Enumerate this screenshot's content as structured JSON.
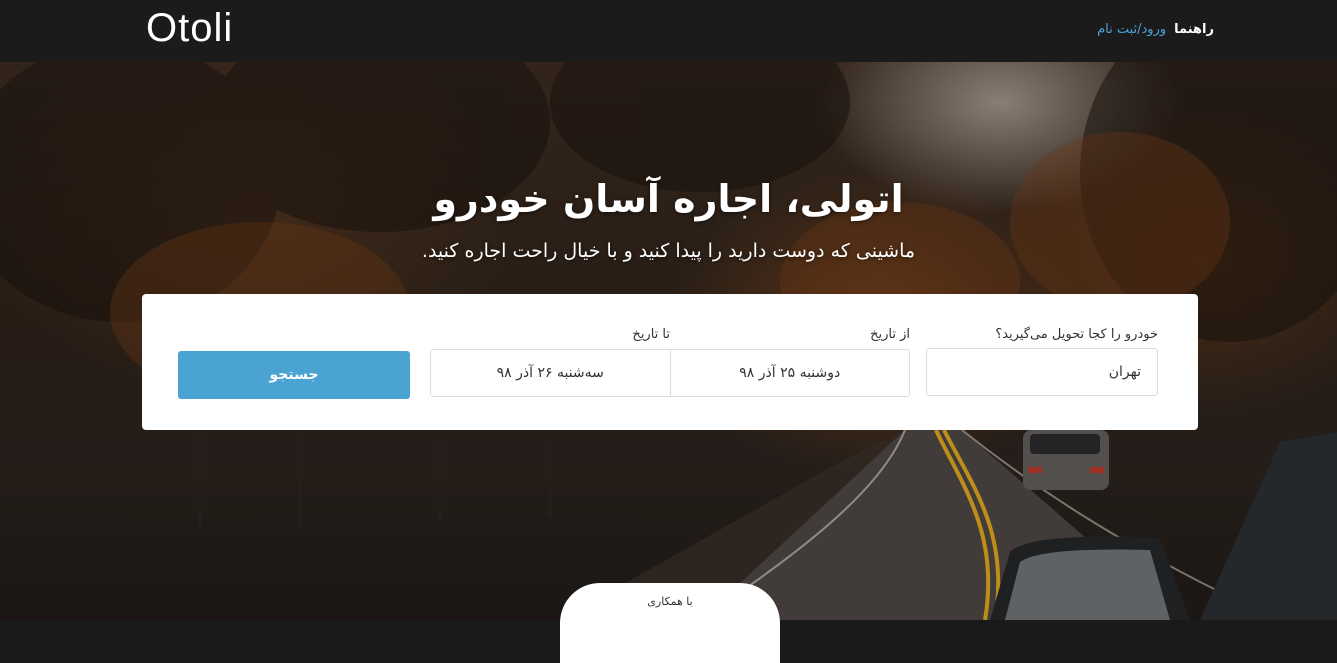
{
  "header": {
    "logo": "Otoli",
    "nav": [
      {
        "label": "راهنما"
      },
      {
        "label": "ورود/ثبت نام"
      }
    ]
  },
  "hero": {
    "title": "اتولی، اجاره آسان خودرو",
    "subtitle": "ماشینی که دوست دارید را پیدا کنید و با خیال راحت اجاره کنید."
  },
  "search": {
    "location_label": "خودرو را کجا تحویل می‌گیرید؟",
    "location_value": "تهران",
    "from_label": "از تاریخ",
    "from_value": "دوشنبه ۲۵ آذر ۹۸",
    "to_label": "تا تاریخ",
    "to_value": "سه‌شنبه ۲۶ آذر ۹۸",
    "button_label": "جستجو"
  },
  "footer_tab": {
    "label": "با همکاری"
  },
  "colors": {
    "navbar": "#1b1b1b",
    "accent": "#4aa3d3",
    "login_link": "#4aa3d8"
  }
}
